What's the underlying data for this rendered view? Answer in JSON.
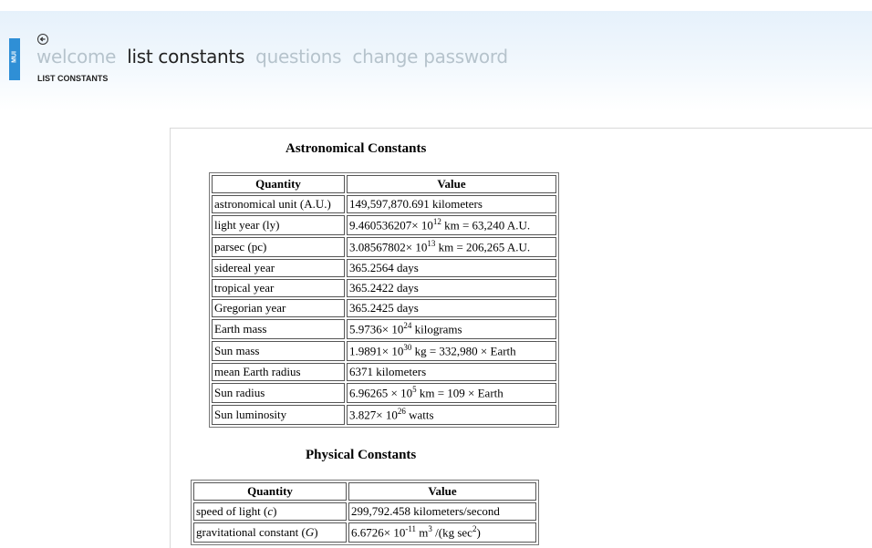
{
  "sidebar_tab": {
    "label": "MUI"
  },
  "nav": {
    "items": [
      {
        "label": "welcome"
      },
      {
        "label": "list constants"
      },
      {
        "label": "questions"
      },
      {
        "label": "change password"
      }
    ]
  },
  "breadcrumb": "LIST CONSTANTS",
  "astronomical": {
    "title": "Astronomical Constants",
    "headers": {
      "quantity": "Quantity",
      "value": "Value"
    },
    "rows": [
      {
        "q": "astronomical unit (A.U.)",
        "v": "149,597,870.691 kilometers"
      },
      {
        "q": "light year (ly)",
        "mant": "9.460536207×",
        "base": "10",
        "exp": "12",
        "rest": " km = 63,240 A.U."
      },
      {
        "q": "parsec (pc)",
        "mant": "3.08567802×",
        "base": "10",
        "exp": "13",
        "rest": " km = 206,265 A.U."
      },
      {
        "q": "sidereal year",
        "v": "365.2564 days"
      },
      {
        "q": "tropical year",
        "v": "365.2422 days"
      },
      {
        "q": "Gregorian year",
        "v": "365.2425 days"
      },
      {
        "q": "Earth mass",
        "mant": "5.9736×",
        "base": "10",
        "exp": "24",
        "rest": " kilograms"
      },
      {
        "q": "Sun mass",
        "mant": "1.9891×",
        "base": "10",
        "exp": "30",
        "rest": " kg = 332,980 × Earth"
      },
      {
        "q": "mean Earth radius",
        "v": "6371 kilometers"
      },
      {
        "q": "Sun radius",
        "mant": "6.96265 ×",
        "base": "10",
        "exp": "5",
        "rest": " km = 109 × Earth"
      },
      {
        "q": "Sun luminosity",
        "mant": "3.827×",
        "base": "10",
        "exp": "26",
        "rest": " watts"
      }
    ]
  },
  "physical": {
    "title": "Physical Constants",
    "headers": {
      "quantity": "Quantity",
      "value": "Value"
    },
    "rows": [
      {
        "q_pre": "speed of light (",
        "q_sym": "c",
        "q_post": ")",
        "v": "299,792.458 kilometers/second"
      },
      {
        "q_pre": "gravitational constant (",
        "q_sym": "G",
        "q_post": ")",
        "mant": "6.6726×",
        "base": "10",
        "exp": "-11",
        "unit1": " m",
        "exp2": "3",
        "unit2": " /(kg sec",
        "exp3": "2",
        "unit3": ")"
      }
    ]
  }
}
